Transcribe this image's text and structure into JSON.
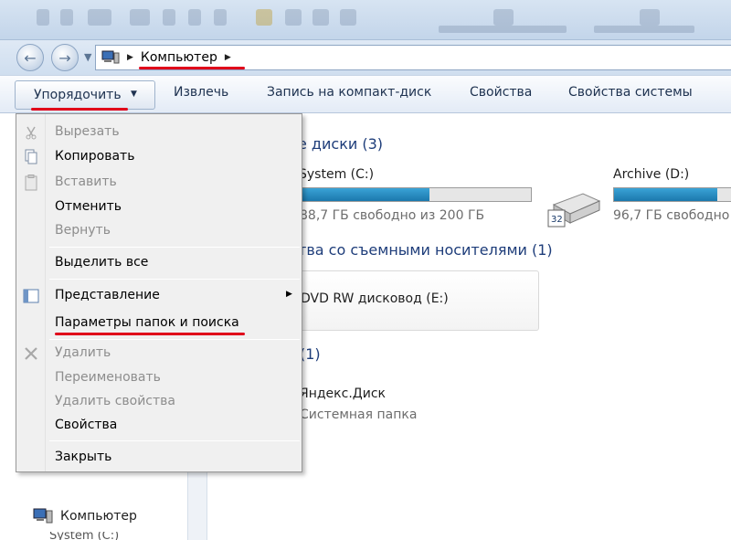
{
  "window": {
    "address": {
      "crumb": "Компьютер"
    }
  },
  "toolbar": {
    "organize": "Упорядочить",
    "eject": "Извлечь",
    "burn": "Запись на компакт-диск",
    "properties": "Свойства",
    "system_properties": "Свойства системы"
  },
  "groups": {
    "hard_disks": {
      "title_partial": "е диски",
      "count": "(3)"
    },
    "removable": {
      "title_partial": "тва со съемными носителями",
      "count": "(1)"
    },
    "other": {
      "count": "(1)"
    }
  },
  "drives": {
    "c": {
      "name": "System (C:)",
      "free": "88,7 ГБ свободно из 200 ГБ",
      "used_fraction": 0.56
    },
    "d": {
      "name": "Archive (D:)",
      "free": "96,7 ГБ свободно",
      "used_fraction": 0.82
    }
  },
  "removable_drives": {
    "dvd": {
      "name": "DVD RW дисковод (E:)"
    }
  },
  "other_items": {
    "yandex": {
      "name": "Яндекс.Диск",
      "type": "Системная папка"
    }
  },
  "nav": {
    "computer": "Компьютер",
    "sub": "System (C:)"
  },
  "menu": {
    "cut": "Вырезать",
    "copy": "Копировать",
    "paste": "Вставить",
    "undo": "Отменить",
    "redo": "Вернуть",
    "select_all": "Выделить все",
    "view": "Представление",
    "folder_options": "Параметры папок и поиска",
    "delete": "Удалить",
    "rename": "Переименовать",
    "remove_properties": "Удалить свойства",
    "properties": "Свойства",
    "close": "Закрыть"
  },
  "colors": {
    "highlight_underline": "#e0001a",
    "group_header": "#1e3d7a",
    "disk_bar_fill": "#1b78ad",
    "disabled_text": "#8d8d8d"
  }
}
